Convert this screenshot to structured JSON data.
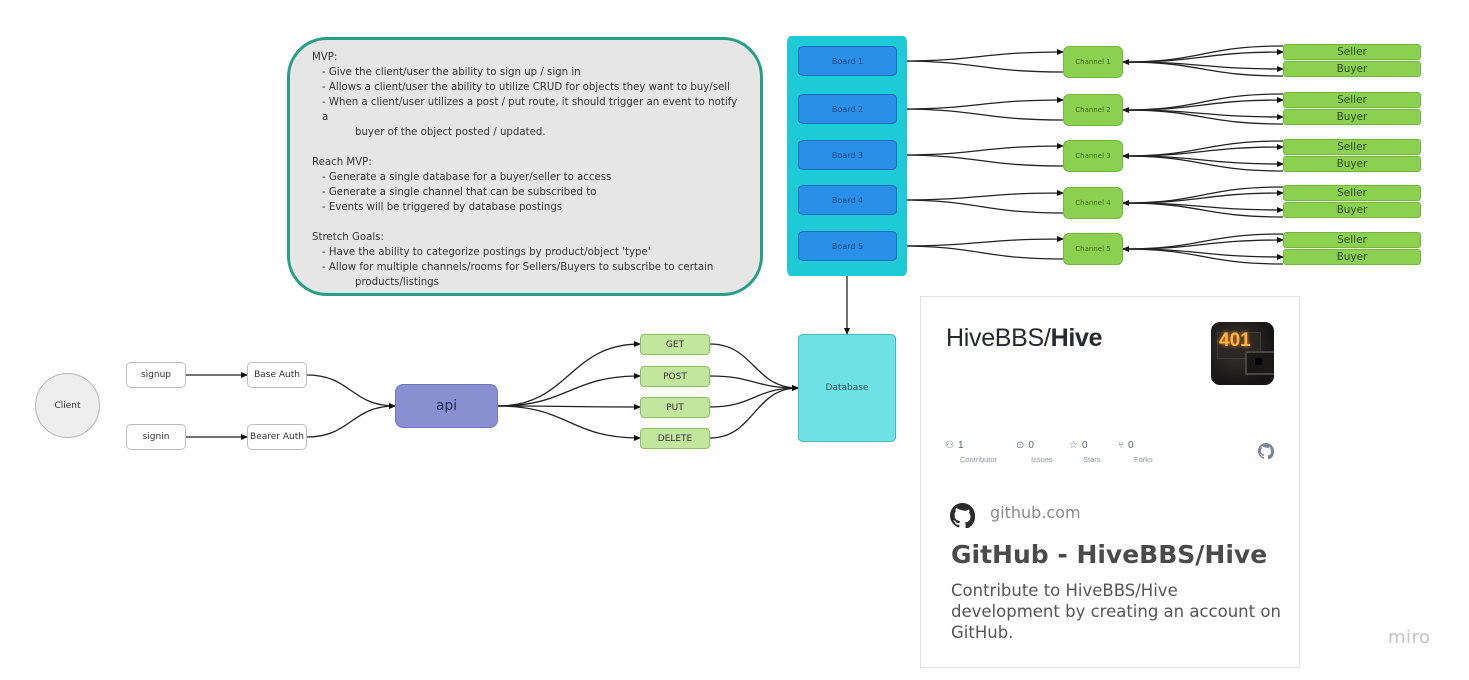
{
  "notes": {
    "sections": [
      {
        "title": "MVP:",
        "lines": [
          {
            "text": "- Give the client/user the ability to sign up / sign in",
            "cont": false
          },
          {
            "text": "- Allows a client/user the ability to utilize CRUD for objects they want to buy/sell",
            "cont": false
          },
          {
            "text": "- When a client/user utilizes a post / put route, it should trigger an event to notify a",
            "cont": false
          },
          {
            "text": "buyer of the object posted / updated.",
            "cont": true
          }
        ]
      },
      {
        "title": "Reach MVP:",
        "lines": [
          {
            "text": "- Generate a single database for a buyer/seller to access",
            "cont": false
          },
          {
            "text": "- Generate a single channel that can be subscribed to",
            "cont": false
          },
          {
            "text": "- Events will be triggered by database postings",
            "cont": false
          }
        ]
      },
      {
        "title": "Stretch Goals:",
        "lines": [
          {
            "text": "- Have the ability to categorize postings by product/object 'type'",
            "cont": false
          },
          {
            "text": "- Allow for multiple channels/rooms for Sellers/Buyers to subscribe to certain",
            "cont": false
          },
          {
            "text": "products/listings",
            "cont": true
          }
        ]
      }
    ]
  },
  "boards": [
    "Board 1",
    "Board 2",
    "Board 3",
    "Board 4",
    "Board 5"
  ],
  "channels": [
    "Channel 1",
    "Channel 2",
    "Channel 3",
    "Channel 4",
    "Channel 5"
  ],
  "roles": {
    "seller": "Seller",
    "buyer": "Buyer"
  },
  "flow": {
    "client": "Client",
    "signup": "signup",
    "signin": "signin",
    "base_auth": "Base Auth",
    "bearer_auth": "Bearer Auth",
    "api": "api",
    "methods": [
      "GET",
      "POST",
      "PUT",
      "DELETE"
    ],
    "database": "Database"
  },
  "github_card": {
    "repo_owner": "HiveBBS/",
    "repo_name": "Hive",
    "avatar_text": "401",
    "stats": [
      {
        "icon": "people-icon",
        "glyph": "⚇",
        "value": "1",
        "label": "Contributor"
      },
      {
        "icon": "issue-icon",
        "glyph": "⊙",
        "value": "0",
        "label": "Issues"
      },
      {
        "icon": "star-icon",
        "glyph": "☆",
        "value": "0",
        "label": "Stars"
      },
      {
        "icon": "fork-icon",
        "glyph": "⑂",
        "value": "0",
        "label": "Forks"
      }
    ],
    "domain": "github.com",
    "title": "GitHub - HiveBBS/Hive",
    "description": "Contribute to HiveBBS/Hive development by creating an account on GitHub."
  },
  "watermark": "miro",
  "colors": {
    "notes_border": "#26a084",
    "board_container": "#1ecad6",
    "board": "#2a8fe8",
    "channel": "#8bd14f",
    "api": "#8a8fd1",
    "method": "#c3e69e",
    "database": "#6fe0e4"
  }
}
